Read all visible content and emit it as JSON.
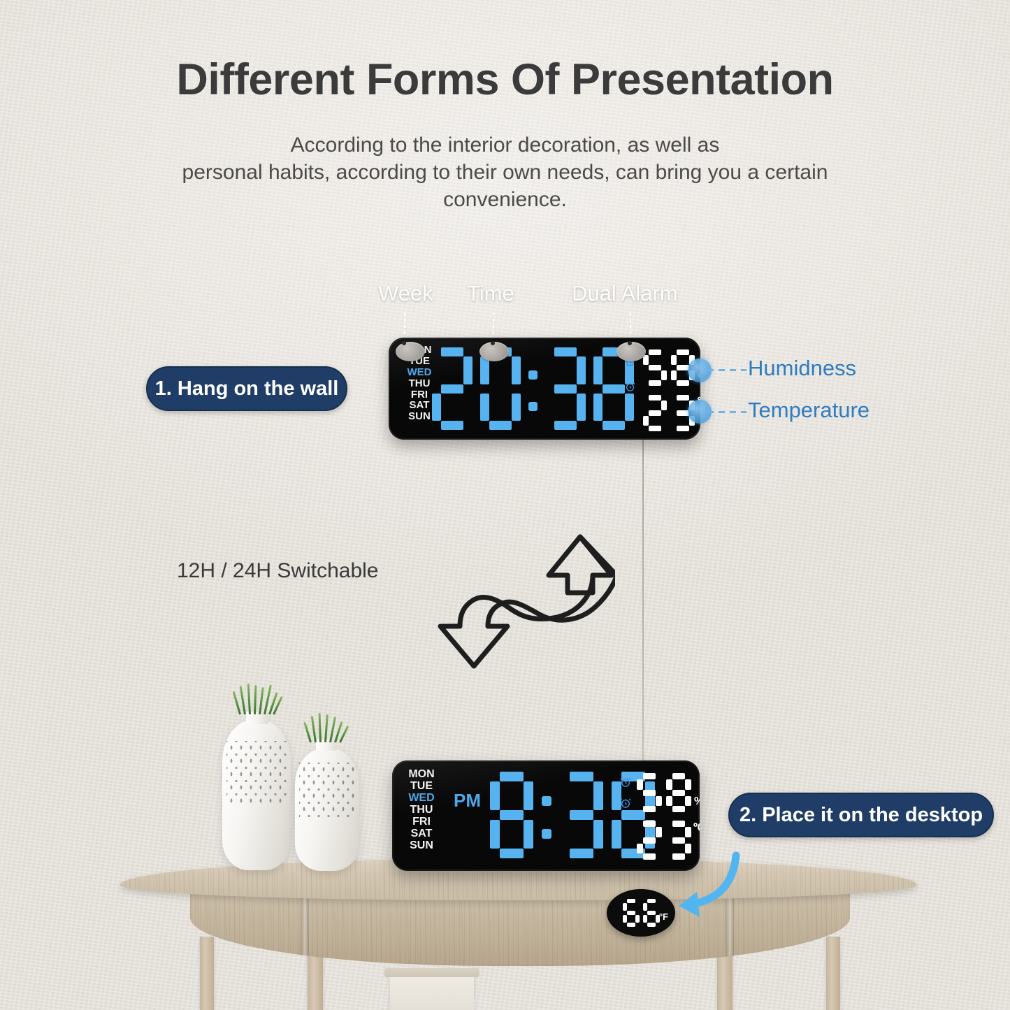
{
  "header": {
    "title": "Different Forms Of Presentation",
    "subtitle_line1": "According to the interior decoration, as well as",
    "subtitle_line2": "personal habits, according to their own needs, can bring you a certain",
    "subtitle_line3": "convenience."
  },
  "callouts": {
    "week": "Week",
    "time": "Time",
    "dual_alarm": "Dual Alarm"
  },
  "annotations": {
    "humidity": "Humidness",
    "temperature": "Temperature"
  },
  "badges": {
    "step1": "1. Hang on the wall",
    "step2": "2. Place it on the desktop"
  },
  "switchable": {
    "label": "12H / 24H Switchable"
  },
  "wall_clock": {
    "days": [
      "MON",
      "TUE",
      "WED",
      "THU",
      "FRI",
      "SAT",
      "SUN"
    ],
    "active_day": "WED",
    "hours": "20",
    "minutes": "38",
    "separator": ":",
    "humidity_value": "58",
    "humidity_unit": "%",
    "temperature_value": "23",
    "temperature_unit": "℃"
  },
  "desk_clock": {
    "days": [
      "MON",
      "TUE",
      "WED",
      "THU",
      "FRI",
      "SAT",
      "SUN"
    ],
    "active_day": "WED",
    "meridiem": "PM",
    "hours": "8",
    "minutes": "38",
    "separator": ":",
    "humidity_value": "58",
    "humidity_unit": "%",
    "temperature_value": "23",
    "temperature_unit": "℃"
  },
  "fahrenheit_badge": {
    "value": "66",
    "unit": "°F"
  },
  "colors": {
    "led_blue": "#57b2f0",
    "led_white": "#ffffff",
    "badge_navy": "#1f3d66",
    "annotation_blue": "#2f7cc0",
    "wall": "#ebe7e1",
    "clock_body": "#080808"
  }
}
